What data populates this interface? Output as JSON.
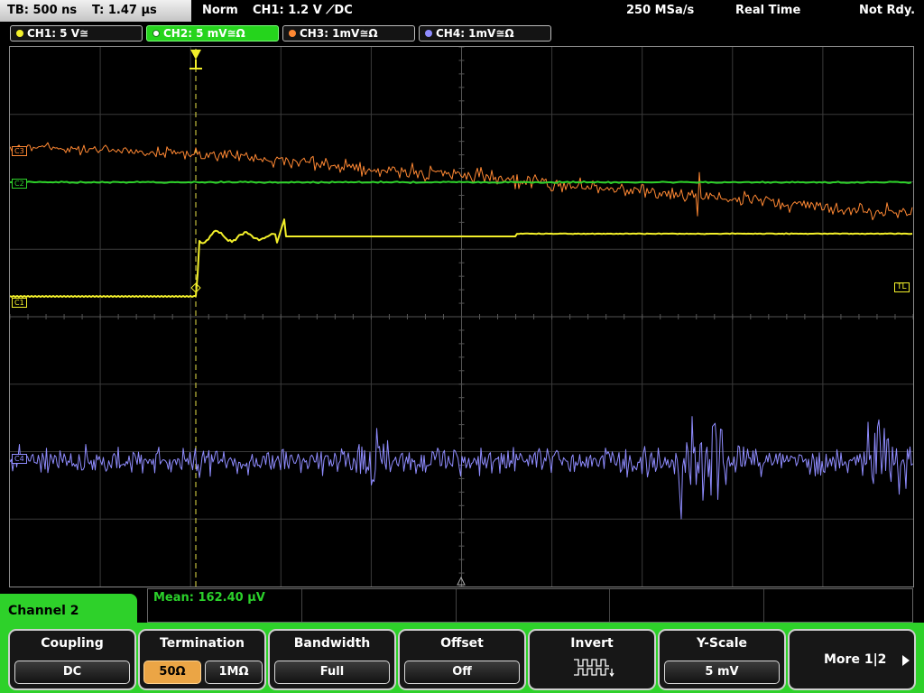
{
  "status": {
    "timebase": "TB: 500 ns",
    "trigger_pos": "T: 1.47 µs",
    "trigger_mode": "Norm",
    "trigger_source": "CH1: 1.2 V ⟋DC",
    "sample_rate": "250 MSa/s",
    "acq_mode": "Real Time",
    "run_state": "Not Rdy."
  },
  "channels": [
    {
      "label": "CH1: 5 V≅",
      "color": "#f2ef2a"
    },
    {
      "label": "CH2: 5 mV≅Ω",
      "color": "#2ed12a"
    },
    {
      "label": "CH3: 1mV≅Ω",
      "color": "#ff8833"
    },
    {
      "label": "CH4: 1mV≅Ω",
      "color": "#8f8cff"
    }
  ],
  "plot": {
    "markers": {
      "ch1_ref": "C1",
      "trigger_level": "TL"
    }
  },
  "measurement": {
    "mean": "Mean: 162.40 µV"
  },
  "menu": {
    "title": "Channel 2",
    "keys": {
      "coupling": {
        "title": "Coupling",
        "value": "DC"
      },
      "termination": {
        "title": "Termination",
        "options": [
          "50Ω",
          "1MΩ"
        ],
        "selected": "50Ω"
      },
      "bandwidth": {
        "title": "Bandwidth",
        "value": "Full"
      },
      "offset": {
        "title": "Offset",
        "value": "Off"
      },
      "invert": {
        "title": "Invert"
      },
      "yscale": {
        "title": "Y-Scale",
        "value": "5 mV"
      },
      "more": {
        "label": "More 1|2"
      }
    }
  },
  "icons": [
    "invert-waveform-icon",
    "next-page-arrow-icon",
    "trigger-marker-icon",
    "channel-dot-icon"
  ]
}
